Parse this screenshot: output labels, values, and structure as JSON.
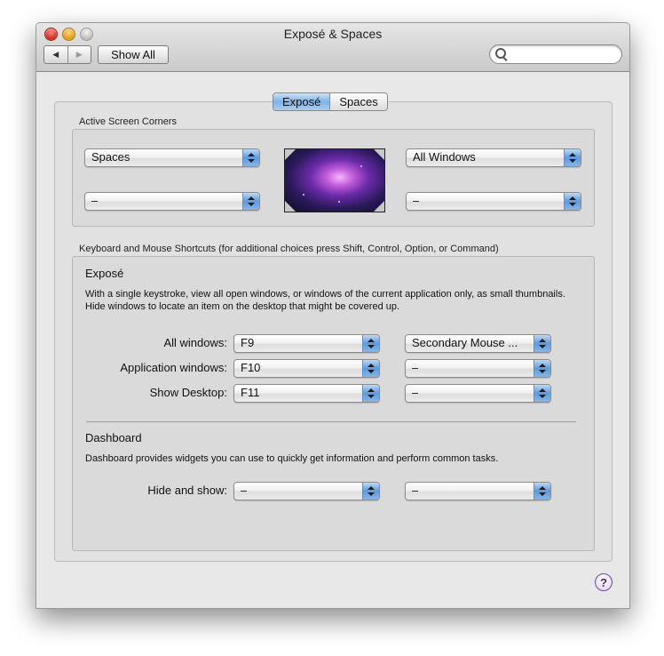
{
  "window": {
    "title": "Exposé & Spaces"
  },
  "toolbar": {
    "back_glyph": "◀",
    "forward_glyph": "▶",
    "show_all_label": "Show All",
    "search_placeholder": ""
  },
  "tabs": [
    {
      "label": "Exposé",
      "active": true
    },
    {
      "label": "Spaces",
      "active": false
    }
  ],
  "corners": {
    "section_label": "Active Screen Corners",
    "top_left": "Spaces",
    "bottom_left": "–",
    "top_right": "All Windows",
    "bottom_right": "–"
  },
  "shortcuts": {
    "section_label": "Keyboard and Mouse Shortcuts (for additional choices press Shift, Control, Option, or Command)",
    "expose": {
      "heading": "Exposé",
      "description": "With a single keystroke, view all open windows, or windows of the current application only, as small thumbnails. Hide windows to locate an item on the desktop that might be covered up.",
      "rows": [
        {
          "label": "All windows:",
          "key": "F9",
          "mouse": "Secondary Mouse ..."
        },
        {
          "label": "Application windows:",
          "key": "F10",
          "mouse": "–"
        },
        {
          "label": "Show Desktop:",
          "key": "F11",
          "mouse": "–"
        }
      ]
    },
    "dashboard": {
      "heading": "Dashboard",
      "description": "Dashboard provides widgets you can use to quickly get information and perform common tasks.",
      "rows": [
        {
          "label": "Hide and show:",
          "key": "–",
          "mouse": "–"
        }
      ]
    }
  },
  "help": {
    "glyph": "?"
  },
  "colors": {
    "accent": "#5a9be0",
    "window_bg": "#e8e8e8"
  }
}
